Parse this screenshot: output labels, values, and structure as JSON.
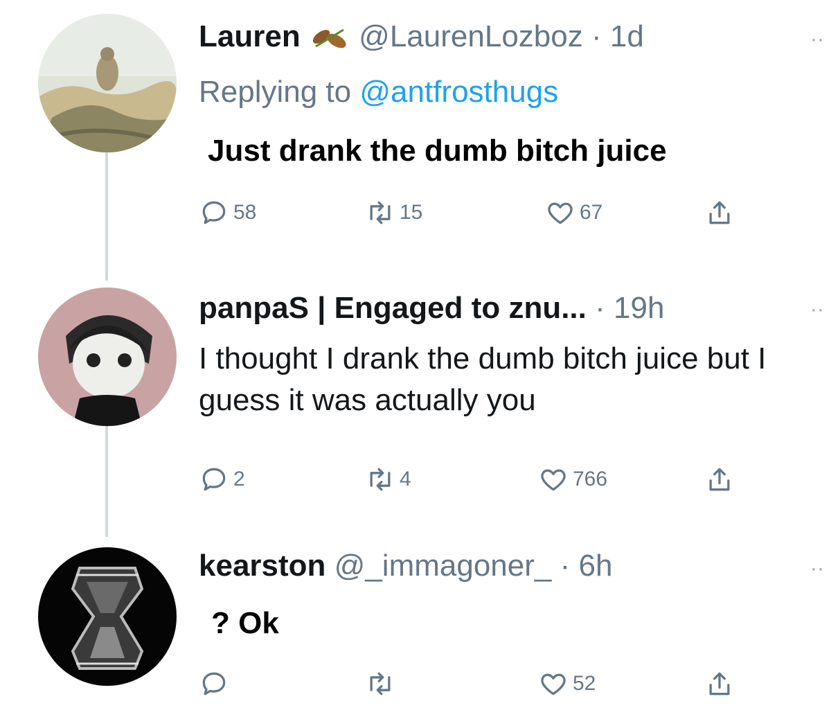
{
  "tweets": [
    {
      "name": "Lauren",
      "badge": "leaf-emoji",
      "handle": "@LaurenLozboz",
      "sep": "·",
      "time": "1d",
      "replying_prefix": "Replying to",
      "replying_handle": "@antfrosthugs",
      "text": "Just drank the dumb bitch juice",
      "replies": "58",
      "retweets": "15",
      "likes": "67"
    },
    {
      "name": "panpaS | Engaged to znu...",
      "sep": "·",
      "time": "19h",
      "text": "I thought I drank the dumb bitch juice but I guess it was actually you",
      "replies": "2",
      "retweets": "4",
      "likes": "766"
    },
    {
      "name": "kearston",
      "handle": "@_immagoner_",
      "sep": "·",
      "time": "6h",
      "text": "? Ok",
      "replies": "",
      "retweets": "",
      "likes": "52"
    }
  ],
  "colors": {
    "accent": "#1da1f2",
    "muted": "#657786",
    "thread_line": "#cfd9de"
  },
  "icons": [
    "reply-icon",
    "retweet-icon",
    "like-icon",
    "share-icon",
    "more-icon"
  ]
}
